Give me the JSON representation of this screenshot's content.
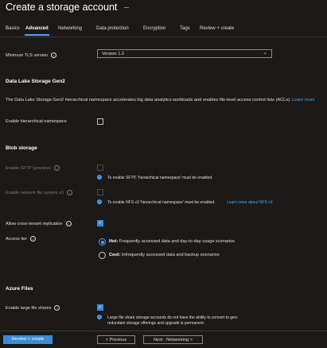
{
  "title": "Create a storage account",
  "tabs": [
    {
      "label": "Basics"
    },
    {
      "label": "Advanced"
    },
    {
      "label": "Networking"
    },
    {
      "label": "Data protection"
    },
    {
      "label": "Encryption"
    },
    {
      "label": "Tags"
    },
    {
      "label": "Review + create"
    }
  ],
  "active_tab": "Advanced",
  "tls": {
    "label": "Minimum TLS version",
    "value": "Version 1.2"
  },
  "datalake": {
    "heading": "Data Lake Storage Gen2",
    "description": "The Data Lake Storage Gen2 hierarchical namespace accelerates big data analytics workloads and enables file-level access control lists (ACLs).",
    "learn_more": "Learn more",
    "hns_label": "Enable hierarchical namespace",
    "hns_checked": false
  },
  "blob": {
    "heading": "Blob storage",
    "sftp_label": "Enable SFTP (preview)",
    "sftp_note": "To enable SFTP, 'hierarchical namespace' must be enabled.",
    "nfs_label": "Enable network file system v3",
    "nfs_note": "To enable NFS v3 'hierarchical namespace' must be enabled.",
    "nfs_note_link": "Learn more about NFS v3",
    "cross_tenant_label": "Allow cross-tenant replication",
    "cross_tenant_checked": true,
    "access_tier_label": "Access tier",
    "access_tiers": [
      {
        "name": "Hot:",
        "desc": "Frequently accessed data and day-to-day usage scenarios",
        "selected": true
      },
      {
        "name": "Cool:",
        "desc": "Infrequently accessed data and backup scenarios",
        "selected": false
      }
    ]
  },
  "files": {
    "heading": "Azure Files",
    "large_shares_label": "Enable large file shares",
    "large_shares_checked": true,
    "large_shares_note_1": "Large file share storage accounts do not have the ability to convert to geo-",
    "large_shares_note_2": "redundant storage offerings and upgrade is permanent."
  },
  "footer": {
    "review_label": "Review + create",
    "previous_label": "< Previous",
    "next_label": "Next : Networking >"
  },
  "colors": {
    "accent": "#4ea1f3",
    "primary_button": "#3b8bd6",
    "background": "#1b1a19"
  }
}
